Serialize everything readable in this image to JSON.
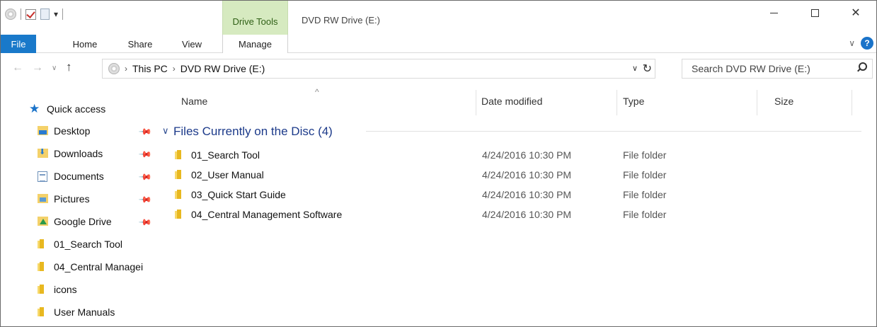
{
  "title_bar": {
    "contextual_tab": "Drive Tools",
    "window_title": "DVD RW Drive (E:)"
  },
  "ribbon": {
    "tabs": [
      "File",
      "Home",
      "Share",
      "View",
      "Manage"
    ]
  },
  "address_bar": {
    "crumbs": [
      "This PC",
      "DVD RW Drive (E:)"
    ]
  },
  "search": {
    "placeholder": "Search DVD RW Drive (E:)"
  },
  "nav_pane": {
    "quick_access": "Quick access",
    "items": [
      {
        "label": "Desktop",
        "icon": "desktop-icon",
        "pinned": true
      },
      {
        "label": "Downloads",
        "icon": "downloads-icon",
        "pinned": true
      },
      {
        "label": "Documents",
        "icon": "documents-icon",
        "pinned": true
      },
      {
        "label": "Pictures",
        "icon": "pictures-icon",
        "pinned": true
      },
      {
        "label": "Google Drive",
        "icon": "google-drive-icon",
        "pinned": true
      },
      {
        "label": "01_Search Tool",
        "icon": "folder-icon",
        "pinned": false
      },
      {
        "label": "04_Central Managei",
        "icon": "folder-icon",
        "pinned": false
      },
      {
        "label": "icons",
        "icon": "folder-icon",
        "pinned": false
      },
      {
        "label": "User Manuals",
        "icon": "folder-icon",
        "pinned": false
      }
    ]
  },
  "columns": {
    "name": "Name",
    "date": "Date modified",
    "type": "Type",
    "size": "Size"
  },
  "group": {
    "label": "Files Currently on the Disc (4)"
  },
  "files": [
    {
      "name": "01_Search Tool",
      "date": "4/24/2016 10:30 PM",
      "type": "File folder"
    },
    {
      "name": "02_User Manual",
      "date": "4/24/2016 10:30 PM",
      "type": "File folder"
    },
    {
      "name": "03_Quick Start Guide",
      "date": "4/24/2016 10:30 PM",
      "type": "File folder"
    },
    {
      "name": "04_Central Management Software",
      "date": "4/24/2016 10:30 PM",
      "type": "File folder"
    }
  ],
  "colors": {
    "file_tab": "#1979ca",
    "drive_tools": "#d6eac0",
    "group_heading": "#1c3a8a"
  }
}
